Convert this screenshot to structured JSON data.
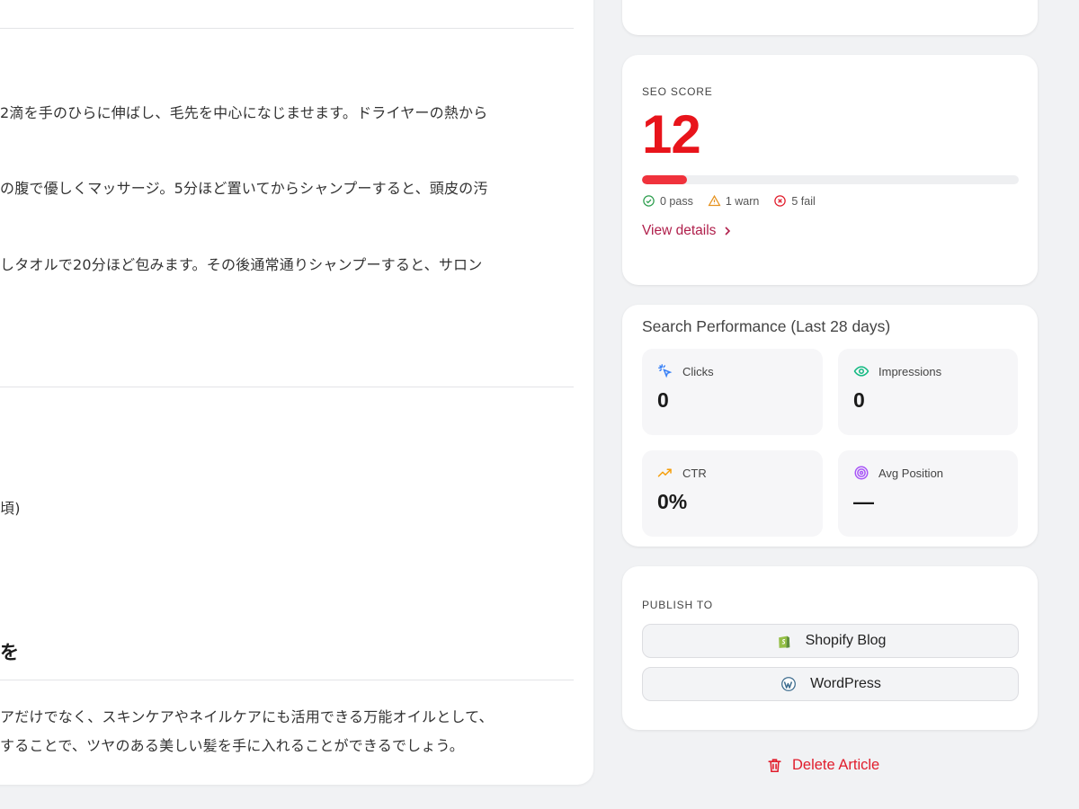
{
  "article": {
    "lines": [
      "2滴を手のひらに伸ばし、毛先を中心になじませます。ドライヤーの熱から",
      "の腹で優しくマッサージ。5分ほど置いてからシャンプーすると、頭皮の汚",
      "しタオルで20分ほど包みます。その後通常通りシャンプーすると、サロン",
      "頃)",
      "アだけでなく、スキンケアやネイルケアにも活用できる万能オイルとして、",
      "することで、ツヤのある美しい髪を手に入れることができるでしょう。"
    ],
    "heading_fragment": "を"
  },
  "seo": {
    "eyebrow": "SEO SCORE",
    "score": "12",
    "progress": 0.12,
    "pass": "0 pass",
    "warn": "1 warn",
    "fail": "5 fail",
    "view_details": "View details",
    "colors": {
      "score": "#e8141b",
      "bar": "#f0323c",
      "pass": "#2e9e4f",
      "warn": "#e6921e",
      "fail": "#e11d2c"
    }
  },
  "performance": {
    "title": "Search Performance (Last 28 days)",
    "metrics": [
      {
        "label": "Clicks",
        "value": "0",
        "icon": "cursor-click-icon",
        "color": "#3b82f6"
      },
      {
        "label": "Impressions",
        "value": "0",
        "icon": "eye-icon",
        "color": "#10b981"
      },
      {
        "label": "CTR",
        "value": "0%",
        "icon": "trending-up-icon",
        "color": "#f59e0b"
      },
      {
        "label": "Avg Position",
        "value": "—",
        "icon": "target-icon",
        "color": "#a855f7"
      }
    ]
  },
  "publish": {
    "eyebrow": "PUBLISH TO",
    "shopify": "Shopify Blog",
    "wordpress": "WordPress"
  },
  "delete_label": "Delete Article"
}
